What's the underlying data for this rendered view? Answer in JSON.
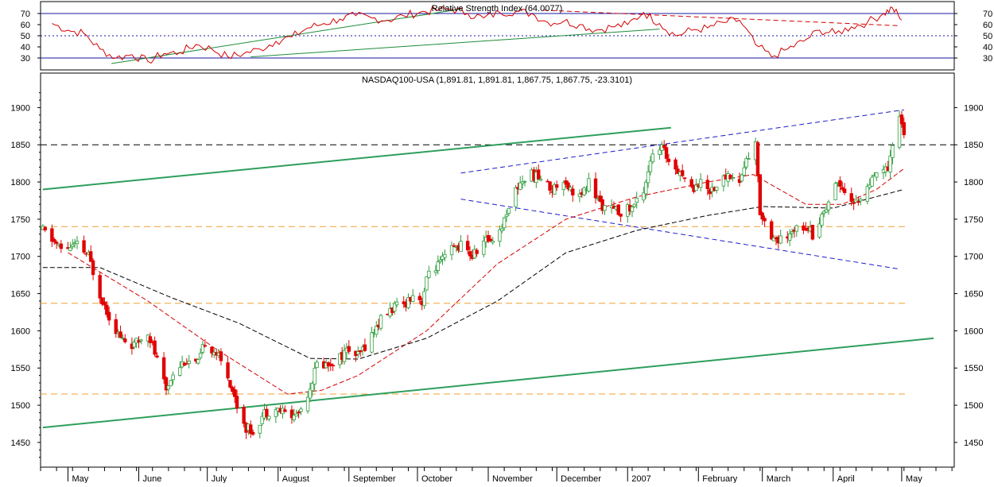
{
  "chart_data": [
    {
      "type": "line",
      "title": "Relative Strength Index (64.0077)",
      "ylim": [
        20,
        80
      ],
      "y_ticks": [
        70,
        60,
        50,
        40,
        30
      ],
      "reference_lines": [
        {
          "value": 70,
          "style": "solid",
          "color": "#1a1aa0"
        },
        {
          "value": 50,
          "style": "dotted",
          "color": "#1a1aa0"
        },
        {
          "value": 30,
          "style": "solid",
          "color": "#1a1aa0"
        }
      ],
      "series_color": "#d40000",
      "rsi_points": [
        [
          "2006-04-24",
          61
        ],
        [
          "2006-05-01",
          55
        ],
        [
          "2006-05-08",
          52
        ],
        [
          "2006-05-15",
          38
        ],
        [
          "2006-05-22",
          30
        ],
        [
          "2006-05-29",
          33
        ],
        [
          "2006-06-05",
          27
        ],
        [
          "2006-06-12",
          34
        ],
        [
          "2006-06-19",
          35
        ],
        [
          "2006-06-26",
          42
        ],
        [
          "2006-07-03",
          38
        ],
        [
          "2006-07-10",
          31
        ],
        [
          "2006-07-17",
          34
        ],
        [
          "2006-07-24",
          38
        ],
        [
          "2006-07-31",
          45
        ],
        [
          "2006-08-07",
          49
        ],
        [
          "2006-08-14",
          57
        ],
        [
          "2006-08-21",
          61
        ],
        [
          "2006-08-28",
          65
        ],
        [
          "2006-09-04",
          68
        ],
        [
          "2006-09-11",
          66
        ],
        [
          "2006-09-18",
          64
        ],
        [
          "2006-09-25",
          68
        ],
        [
          "2006-10-02",
          71
        ],
        [
          "2006-10-09",
          73
        ],
        [
          "2006-10-16",
          74
        ],
        [
          "2006-10-23",
          70
        ],
        [
          "2006-10-30",
          66
        ],
        [
          "2006-11-06",
          71
        ],
        [
          "2006-11-13",
          72
        ],
        [
          "2006-11-20",
          70
        ],
        [
          "2006-11-27",
          62
        ],
        [
          "2006-12-04",
          63
        ],
        [
          "2006-12-11",
          60
        ],
        [
          "2006-12-18",
          55
        ],
        [
          "2006-12-25",
          58
        ],
        [
          "2007-01-01",
          60
        ],
        [
          "2007-01-08",
          71
        ],
        [
          "2007-01-15",
          61
        ],
        [
          "2007-01-22",
          50
        ],
        [
          "2007-01-29",
          55
        ],
        [
          "2007-02-05",
          57
        ],
        [
          "2007-02-12",
          62
        ],
        [
          "2007-02-19",
          64
        ],
        [
          "2007-02-26",
          42
        ],
        [
          "2007-03-05",
          31
        ],
        [
          "2007-03-12",
          38
        ],
        [
          "2007-03-19",
          45
        ],
        [
          "2007-03-26",
          55
        ],
        [
          "2007-04-02",
          52
        ],
        [
          "2007-04-09",
          58
        ],
        [
          "2007-04-16",
          62
        ],
        [
          "2007-04-23",
          70
        ],
        [
          "2007-04-27",
          75
        ],
        [
          "2007-05-01",
          64
        ]
      ],
      "trendlines": [
        {
          "color": "#1e8c3c",
          "from": [
            "2006-05-20",
            25
          ],
          "to": [
            "2006-10-20",
            74
          ]
        },
        {
          "color": "#1e8c3c",
          "from": [
            "2006-07-20",
            31
          ],
          "to": [
            "2007-01-15",
            56
          ]
        },
        {
          "color": "#d40000",
          "dash": true,
          "from": [
            "2006-11-25",
            73
          ],
          "to": [
            "2007-04-30",
            59
          ]
        }
      ]
    },
    {
      "type": "candlestick",
      "title": "NASDAQ100-USA (1,891.81, 1,891.81, 1,867.75, 1,867.75, -23.3101)",
      "ylim": [
        1420,
        1925
      ],
      "y_ticks": [
        1900,
        1850,
        1800,
        1750,
        1700,
        1650,
        1600,
        1550,
        1500,
        1450
      ],
      "x_month_labels": [
        "May",
        "June",
        "July",
        "August",
        "September",
        "October",
        "November",
        "December",
        "2007",
        "February",
        "March",
        "April",
        "May"
      ],
      "up_color": "#2e9e3c",
      "down_color": "#e00000",
      "price_path": [
        [
          "2006-04-20",
          1735
        ],
        [
          "2006-04-28",
          1710
        ],
        [
          "2006-05-05",
          1715
        ],
        [
          "2006-05-10",
          1700
        ],
        [
          "2006-05-15",
          1650
        ],
        [
          "2006-05-19",
          1620
        ],
        [
          "2006-05-24",
          1590
        ],
        [
          "2006-05-30",
          1580
        ],
        [
          "2006-06-05",
          1600
        ],
        [
          "2006-06-08",
          1570
        ],
        [
          "2006-06-13",
          1520
        ],
        [
          "2006-06-16",
          1545
        ],
        [
          "2006-06-21",
          1560
        ],
        [
          "2006-06-27",
          1555
        ],
        [
          "2006-06-30",
          1585
        ],
        [
          "2006-07-05",
          1570
        ],
        [
          "2006-07-10",
          1540
        ],
        [
          "2006-07-14",
          1500
        ],
        [
          "2006-07-18",
          1470
        ],
        [
          "2006-07-21",
          1465
        ],
        [
          "2006-07-26",
          1490
        ],
        [
          "2006-07-31",
          1495
        ],
        [
          "2006-08-04",
          1490
        ],
        [
          "2006-08-08",
          1485
        ],
        [
          "2006-08-11",
          1495
        ],
        [
          "2006-08-15",
          1525
        ],
        [
          "2006-08-18",
          1555
        ],
        [
          "2006-08-23",
          1555
        ],
        [
          "2006-08-28",
          1565
        ],
        [
          "2006-09-01",
          1575
        ],
        [
          "2006-09-05",
          1565
        ],
        [
          "2006-09-08",
          1580
        ],
        [
          "2006-09-12",
          1600
        ],
        [
          "2006-09-15",
          1615
        ],
        [
          "2006-09-20",
          1630
        ],
        [
          "2006-09-25",
          1635
        ],
        [
          "2006-09-29",
          1650
        ],
        [
          "2006-10-03",
          1640
        ],
        [
          "2006-10-06",
          1680
        ],
        [
          "2006-10-11",
          1690
        ],
        [
          "2006-10-16",
          1710
        ],
        [
          "2006-10-20",
          1715
        ],
        [
          "2006-10-25",
          1700
        ],
        [
          "2006-10-30",
          1720
        ],
        [
          "2006-11-03",
          1725
        ],
        [
          "2006-11-07",
          1740
        ],
        [
          "2006-11-10",
          1770
        ],
        [
          "2006-11-15",
          1800
        ],
        [
          "2006-11-20",
          1810
        ],
        [
          "2006-11-24",
          1805
        ],
        [
          "2006-11-29",
          1790
        ],
        [
          "2006-12-04",
          1805
        ],
        [
          "2006-12-07",
          1790
        ],
        [
          "2006-12-12",
          1780
        ],
        [
          "2006-12-15",
          1800
        ],
        [
          "2006-12-19",
          1775
        ],
        [
          "2006-12-22",
          1765
        ],
        [
          "2006-12-28",
          1760
        ],
        [
          "2007-01-03",
          1765
        ],
        [
          "2007-01-08",
          1790
        ],
        [
          "2007-01-11",
          1830
        ],
        [
          "2007-01-16",
          1845
        ],
        [
          "2007-01-19",
          1830
        ],
        [
          "2007-01-24",
          1815
        ],
        [
          "2007-01-29",
          1790
        ],
        [
          "2007-02-01",
          1800
        ],
        [
          "2007-02-06",
          1790
        ],
        [
          "2007-02-09",
          1795
        ],
        [
          "2007-02-14",
          1810
        ],
        [
          "2007-02-19",
          1800
        ],
        [
          "2007-02-22",
          1830
        ],
        [
          "2007-02-26",
          1850
        ],
        [
          "2007-02-28",
          1760
        ],
        [
          "2007-03-05",
          1730
        ],
        [
          "2007-03-08",
          1720
        ],
        [
          "2007-03-13",
          1725
        ],
        [
          "2007-03-16",
          1745
        ],
        [
          "2007-03-21",
          1740
        ],
        [
          "2007-03-23",
          1730
        ],
        [
          "2007-03-28",
          1760
        ],
        [
          "2007-04-02",
          1800
        ],
        [
          "2007-04-05",
          1795
        ],
        [
          "2007-04-10",
          1770
        ],
        [
          "2007-04-13",
          1780
        ],
        [
          "2007-04-18",
          1800
        ],
        [
          "2007-04-23",
          1820
        ],
        [
          "2007-04-25",
          1810
        ],
        [
          "2007-04-27",
          1850
        ],
        [
          "2007-04-30",
          1890
        ],
        [
          "2007-05-02",
          1868
        ]
      ],
      "moving_average_short": {
        "color": "#d40000",
        "dash": true,
        "points": [
          [
            "2006-05-01",
            1705
          ],
          [
            "2006-06-05",
            1640
          ],
          [
            "2006-07-05",
            1575
          ],
          [
            "2006-08-05",
            1515
          ],
          [
            "2006-08-20",
            1520
          ],
          [
            "2006-09-05",
            1540
          ],
          [
            "2006-10-05",
            1600
          ],
          [
            "2006-11-05",
            1690
          ],
          [
            "2006-12-05",
            1750
          ],
          [
            "2007-01-05",
            1780
          ],
          [
            "2007-02-05",
            1800
          ],
          [
            "2007-02-25",
            1810
          ],
          [
            "2007-03-20",
            1770
          ],
          [
            "2007-04-05",
            1770
          ],
          [
            "2007-04-20",
            1790
          ],
          [
            "2007-05-02",
            1818
          ]
        ]
      },
      "moving_average_long": {
        "color": "#000000",
        "dash": true,
        "points": [
          [
            "2006-04-20",
            1685
          ],
          [
            "2006-05-15",
            1685
          ],
          [
            "2006-06-15",
            1645
          ],
          [
            "2006-07-15",
            1610
          ],
          [
            "2006-08-15",
            1563
          ],
          [
            "2006-09-05",
            1562
          ],
          [
            "2006-10-05",
            1590
          ],
          [
            "2006-11-05",
            1640
          ],
          [
            "2006-12-05",
            1705
          ],
          [
            "2007-01-05",
            1735
          ],
          [
            "2007-02-05",
            1755
          ],
          [
            "2007-03-01",
            1767
          ],
          [
            "2007-04-01",
            1765
          ],
          [
            "2007-05-02",
            1790
          ]
        ]
      },
      "horizontal_lines": [
        {
          "value": 1850,
          "color": "#000000",
          "dash": true
        },
        {
          "value": 1740,
          "color": "#f0a030",
          "dash": true
        },
        {
          "value": 1637,
          "color": "#f0a030",
          "dash": true
        },
        {
          "value": 1515,
          "color": "#f0a030",
          "dash": true
        }
      ],
      "trendlines": [
        {
          "color": "#2e9e5c",
          "from": [
            "2006-04-20",
            1790
          ],
          "to": [
            "2007-01-20",
            1873
          ]
        },
        {
          "color": "#2e9e5c",
          "from": [
            "2006-04-20",
            1470
          ],
          "to": [
            "2007-05-15",
            1590
          ]
        },
        {
          "color": "#1a1acc",
          "from": [
            "2006-10-20",
            1812
          ],
          "to": [
            "2007-05-02",
            1897
          ]
        },
        {
          "color": "#1a1acc",
          "from": [
            "2006-10-20",
            1777
          ],
          "to": [
            "2007-04-30",
            1683
          ]
        }
      ]
    }
  ]
}
